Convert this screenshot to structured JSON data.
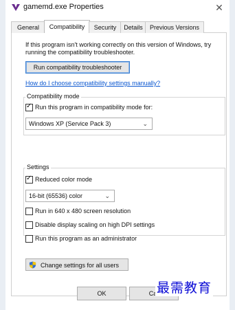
{
  "window": {
    "title": "gamemd.exe Properties"
  },
  "tabs": [
    {
      "label": "General"
    },
    {
      "label": "Compatibility"
    },
    {
      "label": "Security"
    },
    {
      "label": "Details"
    },
    {
      "label": "Previous Versions"
    }
  ],
  "intro_text": "If this program isn't working correctly on this version of Windows, try running the compatibility troubleshooter.",
  "troubleshooter_button": "Run compatibility troubleshooter",
  "help_link": "How do I choose compatibility settings manually?",
  "compat_mode": {
    "group_label": "Compatibility mode",
    "checkbox_label": "Run this program in compatibility mode for:",
    "checked": true,
    "selected_os": "Windows XP (Service Pack 3)"
  },
  "settings": {
    "group_label": "Settings",
    "reduced_color": {
      "label": "Reduced color mode",
      "checked": true
    },
    "color_depth": "16-bit (65536) color",
    "res_640": {
      "label": "Run in 640 x 480 screen resolution",
      "checked": false
    },
    "dpi": {
      "label": "Disable display scaling on high DPI settings",
      "checked": false
    },
    "admin": {
      "label": "Run this program as an administrator",
      "checked": false
    }
  },
  "change_all_users_button": "Change settings for all users",
  "footer": {
    "ok": "OK",
    "cancel": "Car"
  },
  "watermark": "最需教育",
  "colors": {
    "link": "#0b57d0",
    "primary_border": "#3c7fd0",
    "watermark": "#0b0bd6"
  },
  "icons": [
    "app-icon",
    "close-icon",
    "checkmark-icon",
    "chevron-down-icon",
    "uac-shield-icon"
  ]
}
